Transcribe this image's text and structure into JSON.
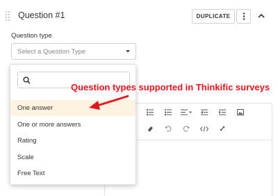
{
  "question": {
    "title": "Question #1",
    "duplicate_label": "DUPLICATE",
    "more_icon": "vertical-dots-icon",
    "collapse_icon": "chevron-up-icon"
  },
  "question_type": {
    "label": "Question type",
    "placeholder": "Select a Question Type",
    "search_placeholder": "",
    "options": [
      "One answer",
      "One or more answers",
      "Rating",
      "Scale",
      "Free Text"
    ],
    "highlighted_option": "One answer"
  },
  "annotation": {
    "text": "Question types supported in Thinkific surveys",
    "color": "#e8141b"
  },
  "colors": {
    "highlight": "#fdf3e0",
    "border": "#cfcfcf"
  }
}
